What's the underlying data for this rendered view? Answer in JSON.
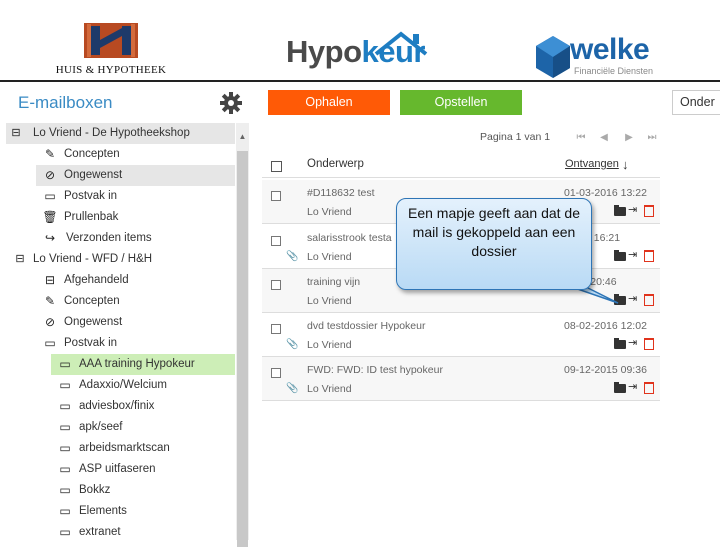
{
  "header": {
    "logo_left": {
      "text": "HUIS & HYPOTHEEK"
    },
    "logo_center": {
      "part1": "Hypo",
      "part2": "keur"
    },
    "logo_right": {
      "name": "welke",
      "subtitle": "Financiële Diensten"
    }
  },
  "sidebar": {
    "title": "E-mailboxen",
    "groups": [
      {
        "label": "Lo Vriend - De Hypotheekshop",
        "items": [
          {
            "label": "Concepten",
            "icon": "pencil-icon"
          },
          {
            "label": "Ongewenst",
            "icon": "ban-icon",
            "selected": true
          },
          {
            "label": "Postvak in",
            "icon": "inbox-icon"
          },
          {
            "label": "Prullenbak",
            "icon": "trash-icon"
          },
          {
            "label": "Verzonden items",
            "icon": "share-icon"
          }
        ]
      },
      {
        "label": "Lo Vriend - WFD / H&H",
        "items": [
          {
            "label": "Afgehandeld",
            "icon": "archive-icon"
          },
          {
            "label": "Concepten",
            "icon": "pencil-icon"
          },
          {
            "label": "Ongewenst",
            "icon": "ban-icon"
          },
          {
            "label": "Postvak in",
            "icon": "inbox-icon"
          }
        ]
      }
    ],
    "subfolders": [
      {
        "label": "AAA training Hypokeur",
        "highlighted": true
      },
      {
        "label": "Adaxxio/Welcium"
      },
      {
        "label": "adviesbox/finix"
      },
      {
        "label": "apk/seef"
      },
      {
        "label": "arbeidsmarktscan"
      },
      {
        "label": "ASP uitfaseren"
      },
      {
        "label": "Bokkz"
      },
      {
        "label": "Elements"
      },
      {
        "label": "extranet"
      }
    ]
  },
  "toolbar": {
    "fetch_label": "Ophalen",
    "compose_label": "Opstellen",
    "fetch_color": "#ff5a06",
    "compose_color": "#66b82d",
    "right_panel_label": "Onder"
  },
  "pager": {
    "text": "Pagina 1 van 1"
  },
  "columns": {
    "subject": "Onderwerp",
    "received": "Ontvangen"
  },
  "emails": [
    {
      "subject": "#D118632 test",
      "from": "Lo Vriend",
      "date": "01-03-2016 13:22",
      "attachment": false
    },
    {
      "subject": "salarisstrook testa",
      "from": "Lo Vriend",
      "date": "-2016 16:21",
      "attachment": true
    },
    {
      "subject": "training vijn",
      "from": "Lo Vriend",
      "date": "2016 20:46",
      "attachment": false
    },
    {
      "subject": "dvd testdossier Hypokeur",
      "from": "Lo Vriend",
      "date": "08-02-2016 12:02",
      "attachment": true
    },
    {
      "subject": "FWD: FWD: ID test hypokeur",
      "from": "Lo Vriend",
      "date": "09-12-2015 09:36",
      "attachment": true
    }
  ],
  "callout": {
    "text": "Een mapje geeft aan dat de mail is gekoppeld aan een dossier"
  }
}
